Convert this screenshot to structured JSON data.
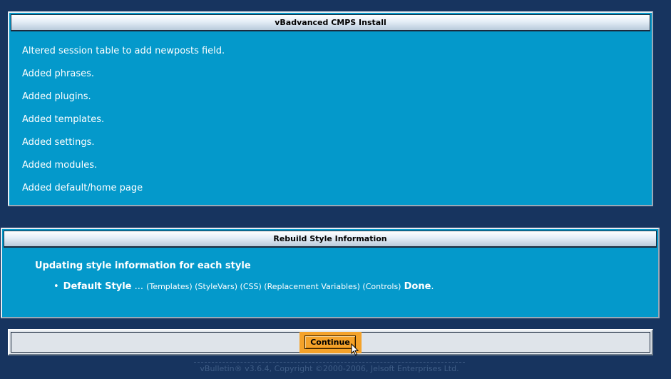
{
  "install_panel": {
    "title": "vBadvanced CMPS Install",
    "lines": [
      "Altered session table to add newposts field.",
      "Added phrases.",
      "Added plugins.",
      "Added templates.",
      "Added settings.",
      "Added modules.",
      "Added default/home page"
    ]
  },
  "rebuild_panel": {
    "title": "Rebuild Style Information",
    "heading": "Updating style information for each style",
    "item": {
      "name": "Default Style",
      "ellipsis": "...",
      "steps": "(Templates) (StyleVars) (CSS) (Replacement Variables) (Controls)",
      "done": "Done",
      "period": "."
    }
  },
  "continue_button": {
    "label": "Continue"
  },
  "footer": {
    "copyright": "vBulletin® v3.6.4, Copyright ©2000-2006, Jelsoft Enterprises Ltd."
  },
  "icons": {
    "cursor": "arrow-cursor-icon",
    "bullet": "bullet-icon"
  },
  "colors": {
    "page_background": "#17345f",
    "panel_background": "#0499cb",
    "button_highlight": "#f4a22a",
    "footer_text": "#3f5d86"
  }
}
